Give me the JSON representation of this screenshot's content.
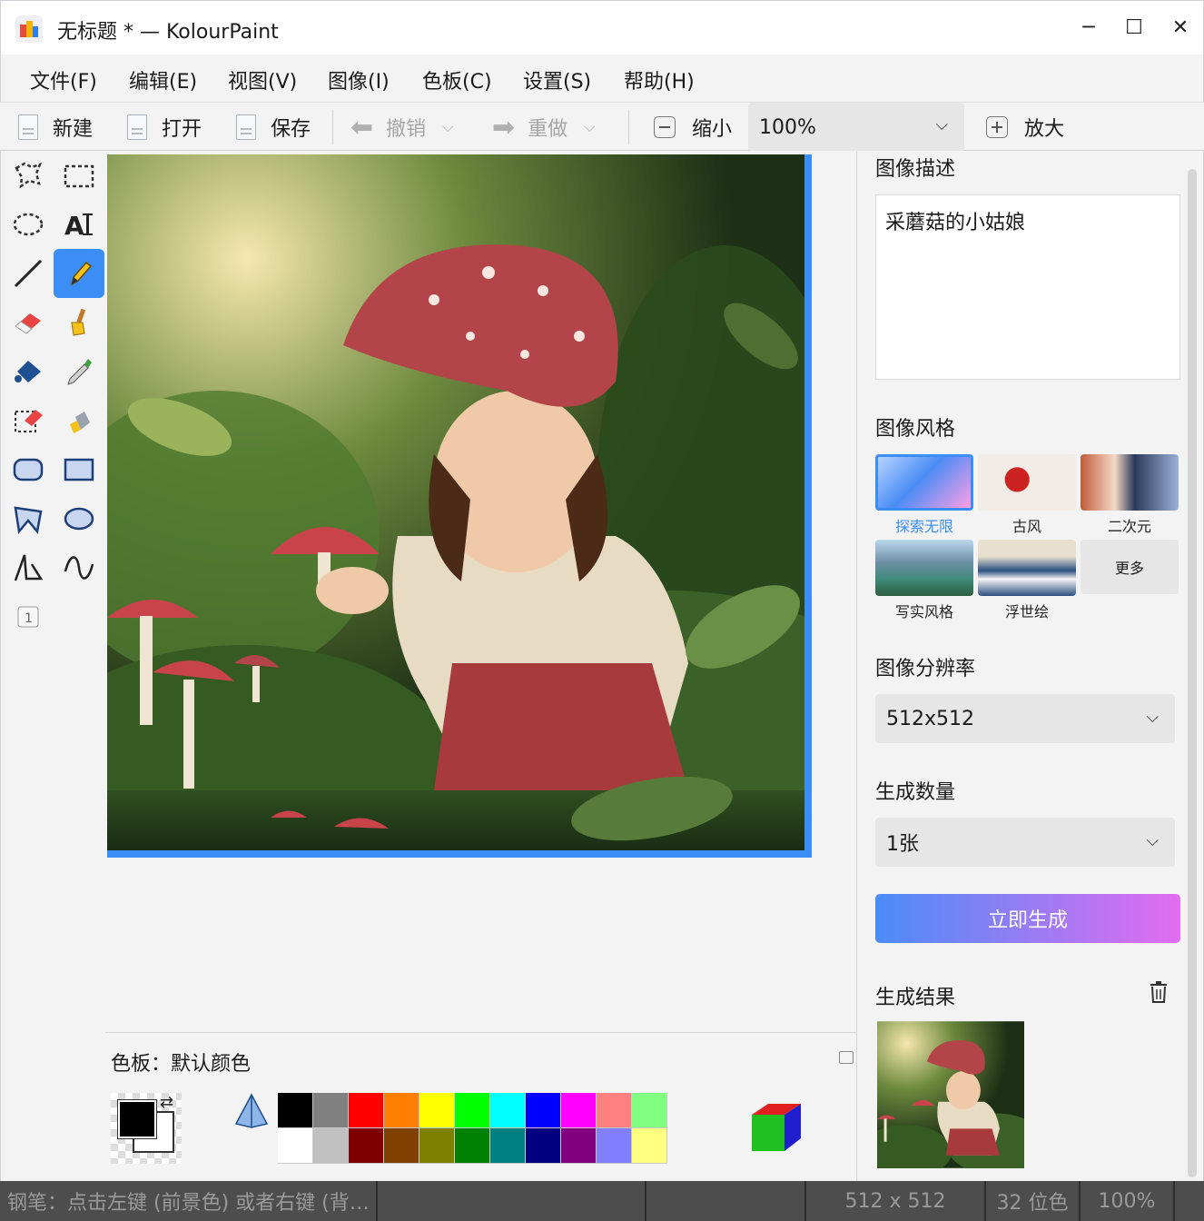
{
  "window": {
    "title": "无标题 * — KolourPaint",
    "minimize_label": "─",
    "maximize_label": "☐",
    "close_label": "✕"
  },
  "menu": [
    "文件(F)",
    "编辑(E)",
    "视图(V)",
    "图像(I)",
    "色板(C)",
    "设置(S)",
    "帮助(H)"
  ],
  "toolbar": {
    "new_label": "新建",
    "open_label": "打开",
    "save_label": "保存",
    "undo_label": "撤销",
    "redo_label": "重做",
    "zoom_out_label": "缩小",
    "zoom_value": "100%",
    "zoom_in_label": "放大"
  },
  "tools": {
    "active": "pen-tool"
  },
  "palette": {
    "title": "色板：默认颜色",
    "colors_row1": [
      "#000000",
      "#808080",
      "#ff0000",
      "#ff8000",
      "#ffff00",
      "#00ff00",
      "#00ffff",
      "#0000ff",
      "#ff00ff",
      "#ff8080",
      "#80ff80"
    ],
    "colors_row2": [
      "#ffffff",
      "#c0c0c0",
      "#800000",
      "#804000",
      "#808000",
      "#008000",
      "#008080",
      "#000080",
      "#800080",
      "#8080ff",
      "#ffff80"
    ]
  },
  "sidepanel": {
    "description_heading": "图像描述",
    "description_value": "采蘑菇的小姑娘",
    "style_heading": "图像风格",
    "styles": [
      "探索无限",
      "古风",
      "二次元",
      "写实风格",
      "浮世绘"
    ],
    "selected_style": "探索无限",
    "more_label": "更多",
    "resolution_heading": "图像分辨率",
    "resolution_value": "512x512",
    "count_heading": "生成数量",
    "count_value": "1张",
    "generate_label": "立即生成",
    "result_heading": "生成结果"
  },
  "statusbar": {
    "hint": "钢笔：点击左键 (前景色) 或者右键 (背…",
    "size": "512 x 512",
    "depth": "32 位色",
    "zoom": "100%"
  },
  "colors": {
    "accent": "#3b8ef5",
    "generate_gradient_start": "#4b8cf7",
    "generate_gradient_end": "#e36cf0"
  }
}
